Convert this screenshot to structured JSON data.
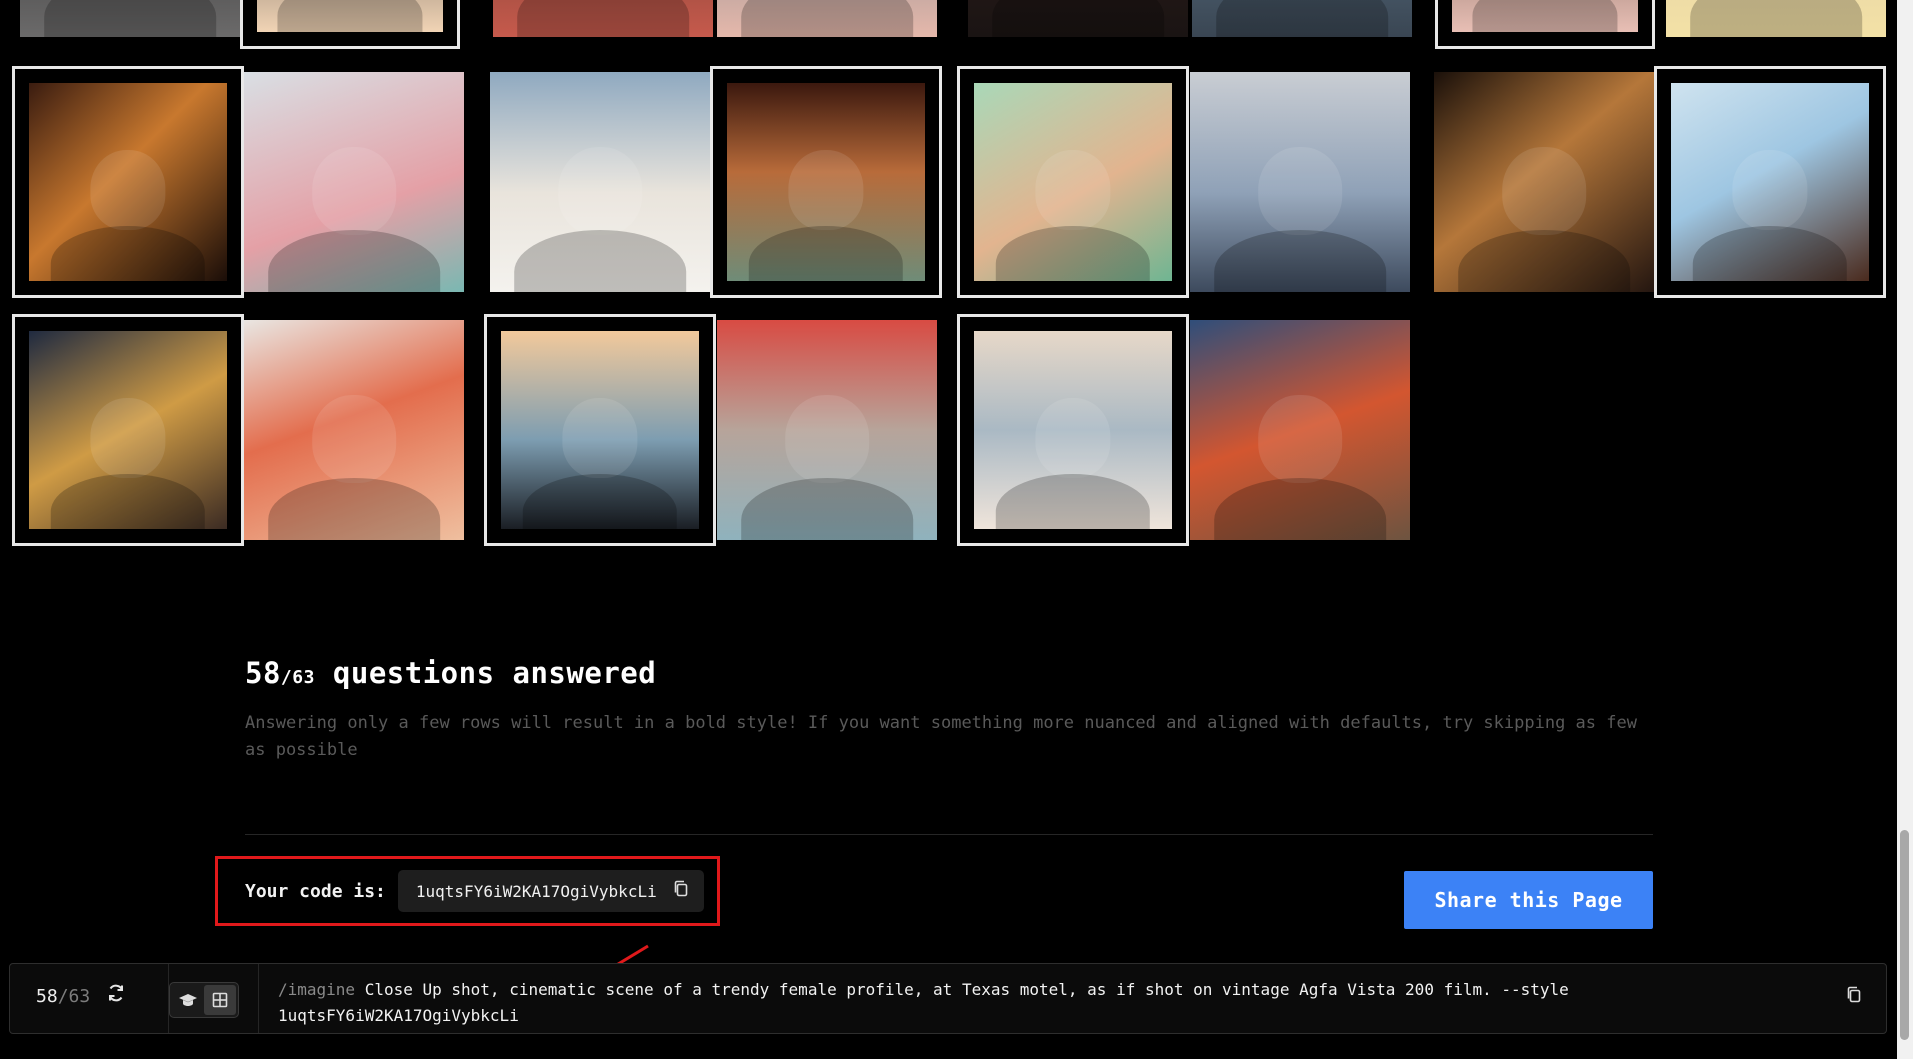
{
  "progress": {
    "answered": "58",
    "separator": "/",
    "total": "63",
    "title_suffix": "questions answered",
    "description": "Answering only a few rows will result in a bold style! If you want something more nuanced and aligned with defaults, try skipping as few as possible"
  },
  "code": {
    "label": "Your code is:",
    "value": "1uqtsFY6iW2KA17OgiVybkcLi"
  },
  "share": {
    "label": "Share this Page"
  },
  "bottom_bar": {
    "answered": "58",
    "separator": "/",
    "total": "63",
    "command": "/imagine",
    "prompt": "Close Up shot, cinematic scene of a trendy female profile, at Texas motel, as if shot on vintage Agfa Vista 200 film. --style 1uqtsFY6iW2KA17OgiVybkcLi"
  },
  "icons": {
    "copy": "copy-icon",
    "refresh": "refresh-icon",
    "learn": "graduation-cap-icon",
    "grid": "grid-icon"
  },
  "colors": {
    "accent": "#3c82f6",
    "highlight_box": "#e0191b",
    "background": "#000000"
  }
}
